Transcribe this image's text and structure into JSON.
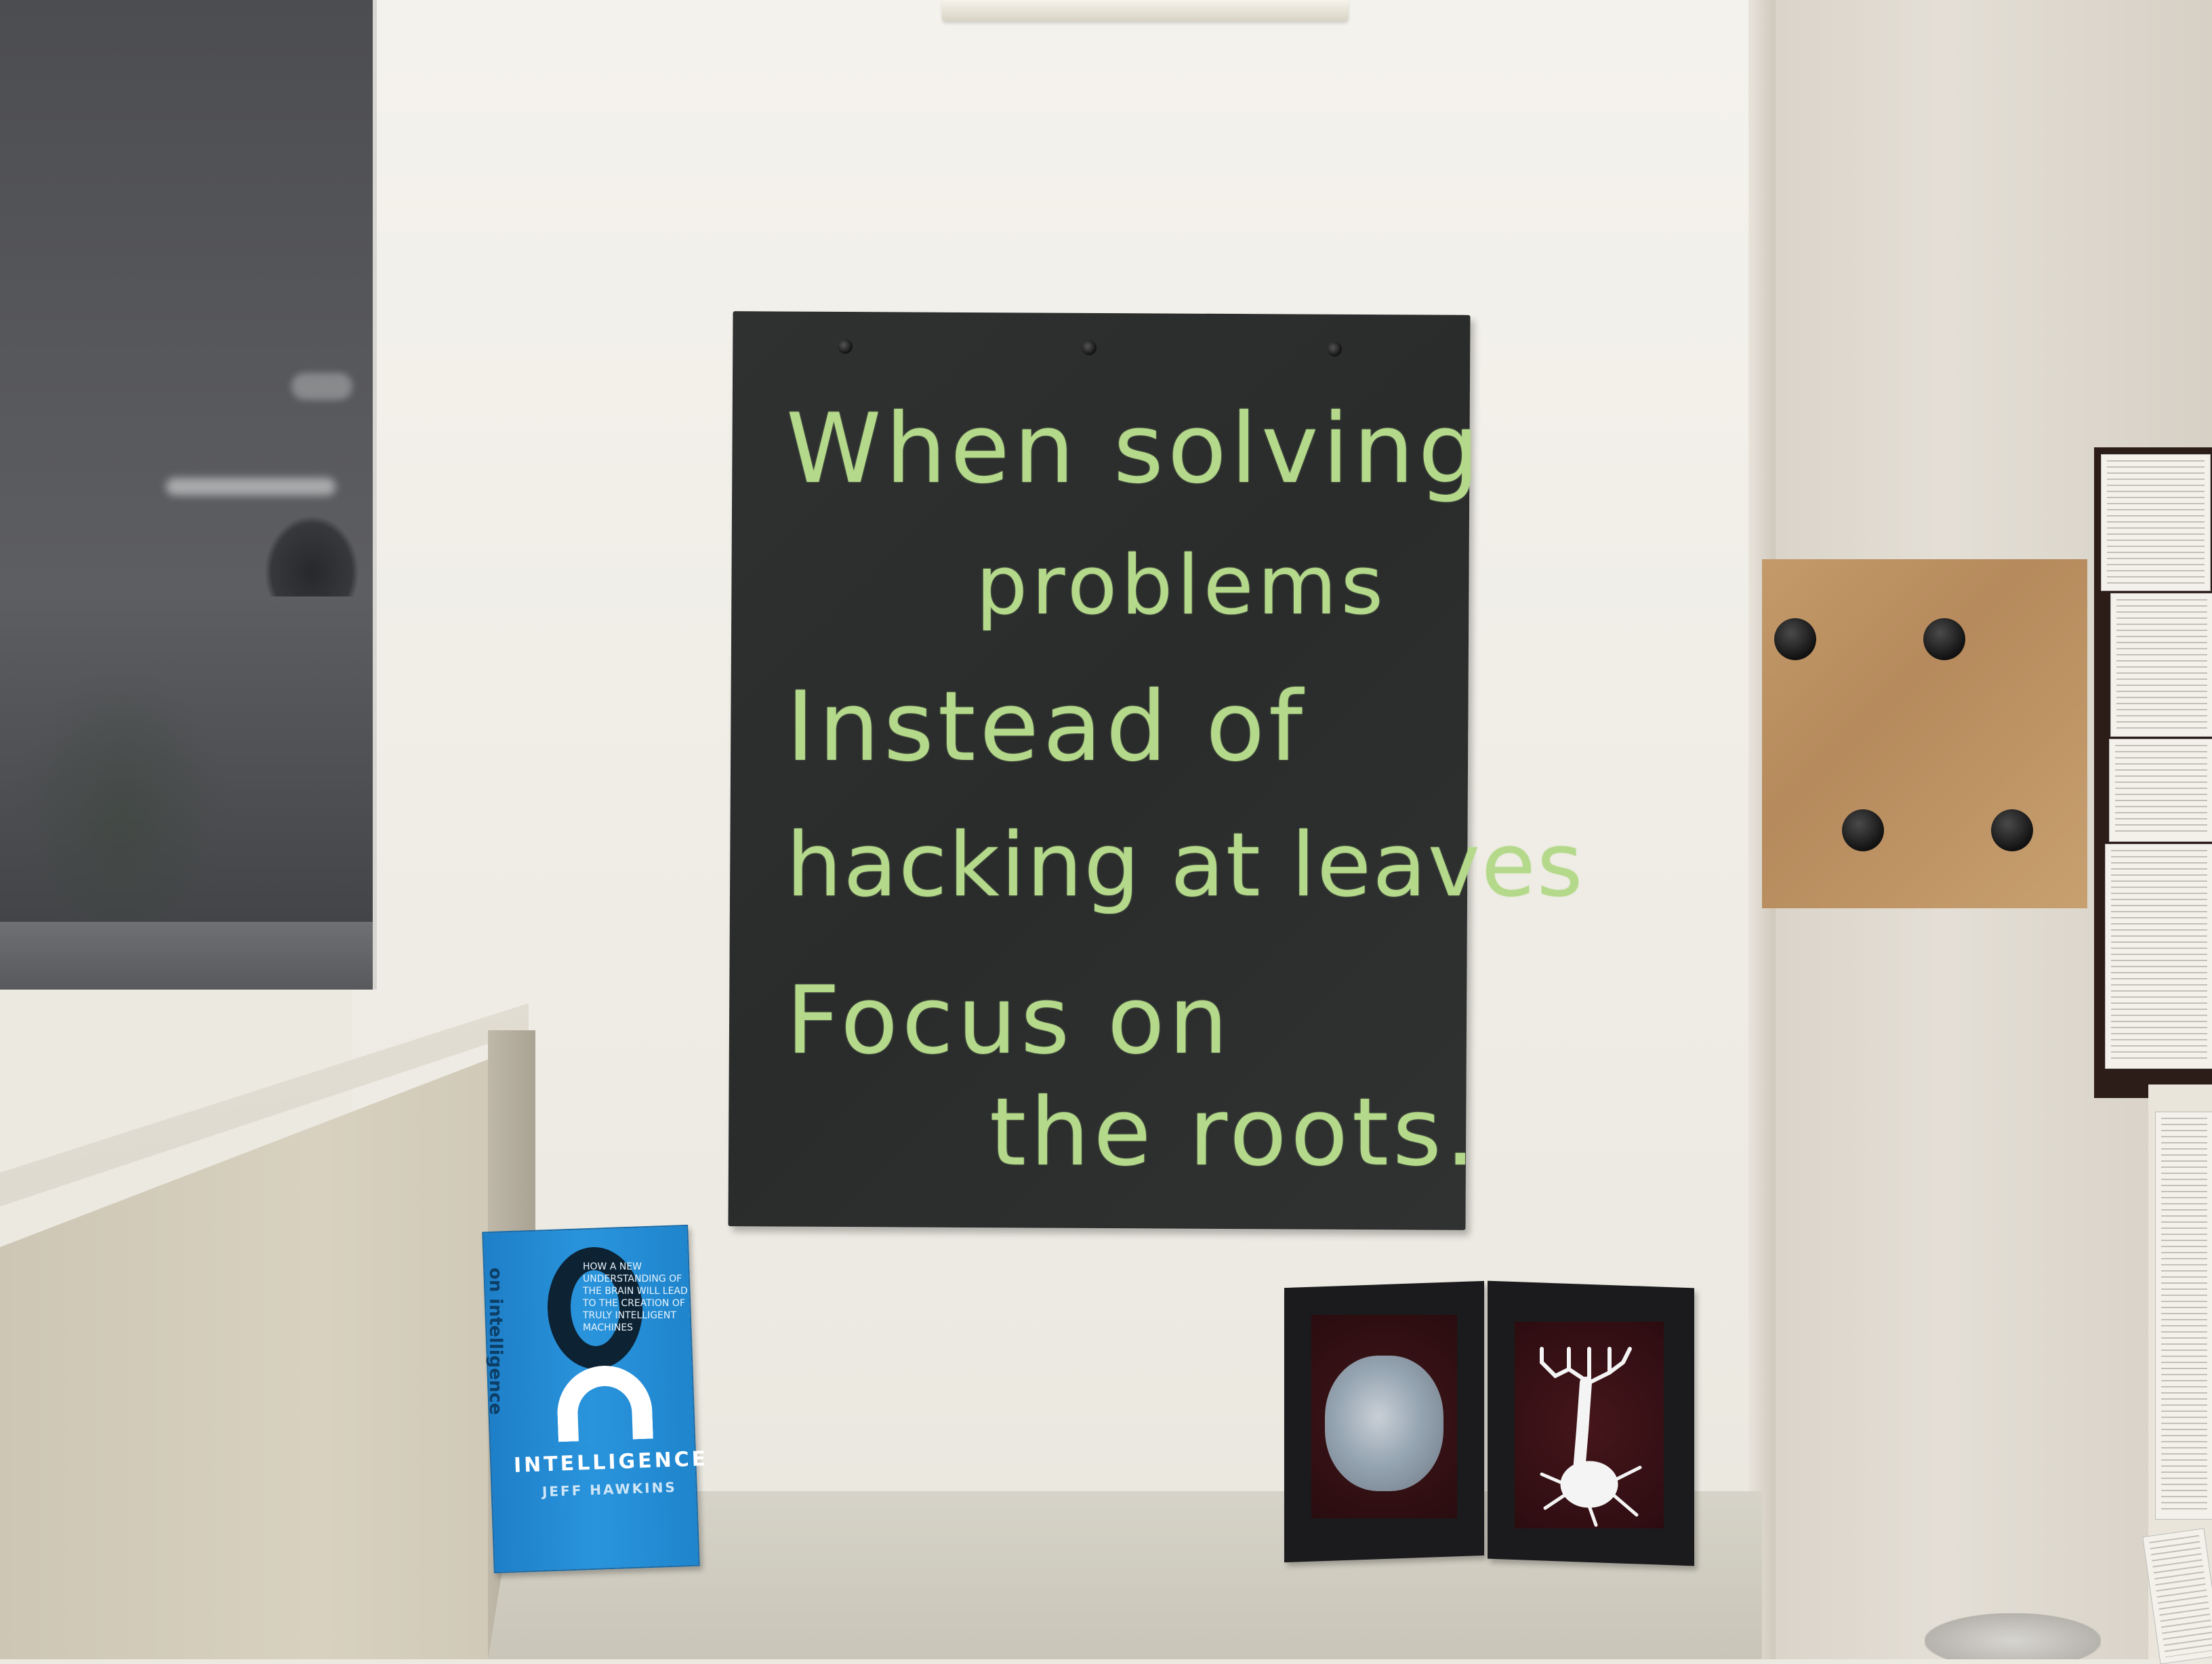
{
  "chalkboard": {
    "lines": [
      "When solving",
      "problems",
      "Instead of",
      "hacking at leaves",
      "Focus on",
      "the roots."
    ]
  },
  "book": {
    "spine": "on intelligence",
    "title": "INTELLIGENCE",
    "author": "JEFF HAWKINS",
    "blurb": "HOW A NEW UNDERSTANDING OF THE BRAIN WILL LEAD TO THE CREATION OF TRULY INTELLIGENT MACHINES"
  },
  "colors": {
    "chalk": "#b4d98a",
    "chalkboard": "#2d2f2f",
    "book_cover": "#2994dc",
    "wall": "#f0eee7",
    "coat_board": "#c49a6a"
  }
}
